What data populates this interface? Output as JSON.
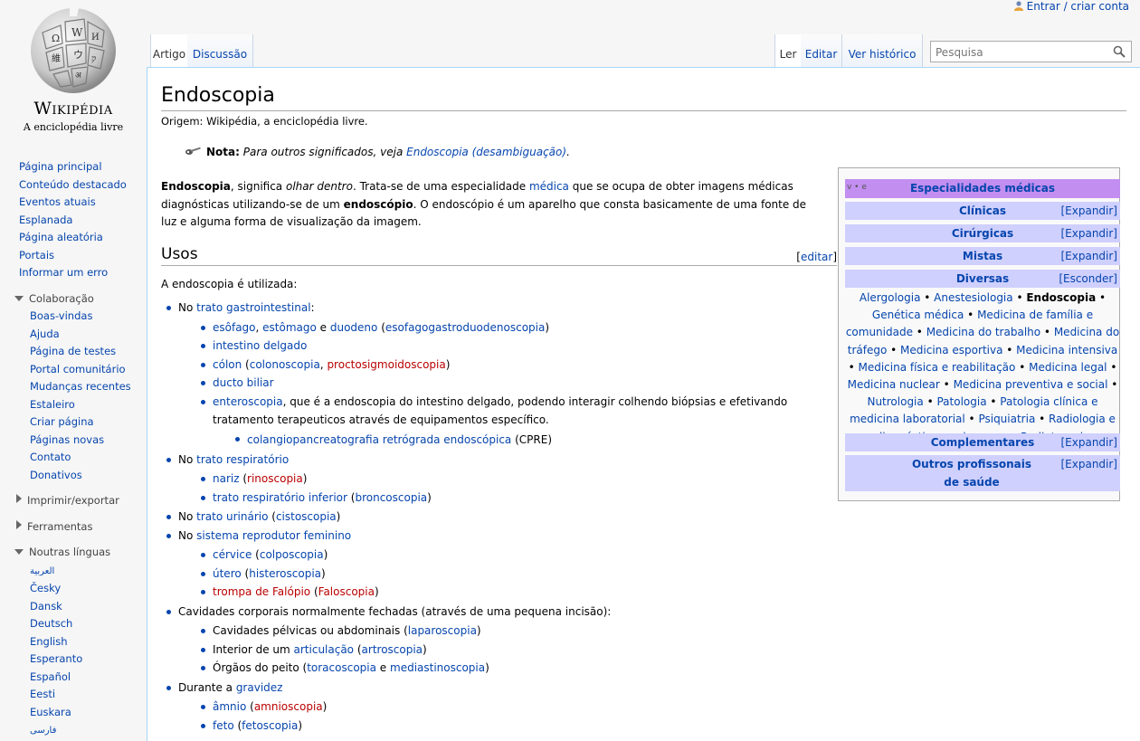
{
  "personal": {
    "login": "Entrar / criar conta"
  },
  "logo": {
    "wordmark": "Wikipédia",
    "tagline": "A enciclopédia livre"
  },
  "sidebar": {
    "main": [
      "Página principal",
      "Conteúdo destacado",
      "Eventos atuais",
      "Esplanada",
      "Página aleatória",
      "Portais",
      "Informar um erro"
    ],
    "collab_head": "Colaboração",
    "collab": [
      "Boas-vindas",
      "Ajuda",
      "Página de testes",
      "Portal comunitário",
      "Mudanças recentes",
      "Estaleiro",
      "Criar página",
      "Páginas novas",
      "Contato",
      "Donativos"
    ],
    "print_head": "Imprimir/exportar",
    "tools_head": "Ferramentas",
    "langs_head": "Noutras línguas",
    "langs": [
      "العربية",
      "Česky",
      "Dansk",
      "Deutsch",
      "English",
      "Esperanto",
      "Español",
      "Eesti",
      "Euskara",
      "فارسی"
    ]
  },
  "tabs": {
    "article": "Artigo",
    "discussion": "Discussão",
    "read": "Ler",
    "edit": "Editar",
    "history": "Ver histórico"
  },
  "search": {
    "placeholder": "Pesquisa"
  },
  "article": {
    "title": "Endoscopia",
    "sitesub": "Origem: Wikipédia, a enciclopédia livre.",
    "hatnote": {
      "label": "Nota:",
      "text": "Para outros significados, veja",
      "link": "Endoscopia (desambiguação)",
      "end": "."
    },
    "intro": {
      "t1": "Endoscopia",
      "t2": ", significa ",
      "t3": "olhar dentro",
      "t4": ". Trata-se de uma especialidade ",
      "l1": "médica",
      "t5": " que se ocupa de obter imagens médicas diagnósticas utilizando-se de um ",
      "t6": "endoscópio",
      "t7": ". O endoscópio é um aparelho que consta basicamente de uma fonte de luz e alguma forma de visualização da imagem."
    },
    "usos": {
      "heading": "Usos",
      "edit": "editar",
      "intro": "A endoscopia é utilizada:"
    },
    "uses": {
      "gi": {
        "pre": "No ",
        "link": "trato gastrointestinal",
        "post": ":"
      },
      "gi_items": {
        "a1": "esôfago",
        "a2": ", ",
        "a3": "estômago",
        "a4": " e ",
        "a5": "duodeno",
        "a6": " (",
        "a7": "esofagogastroduodenoscopia",
        "a8": ")",
        "b": "intestino delgado",
        "c1": "cólon",
        "c2": " (",
        "c3": "colonoscopia",
        "c4": ", ",
        "c5": "proctosigmoidoscopia",
        "c6": ")",
        "d": "ducto biliar",
        "e1": "enteroscopia",
        "e2": ", que é a endoscopia do intestino delgado, podendo interagir colhendo biópsias e efetivando tratamento terapeuticos através de equipamentos específico.",
        "f1": "colangiopancreatografia retrógrada endoscópica",
        "f2": " (CPRE)"
      },
      "resp": {
        "pre": "No ",
        "link": "trato respiratório"
      },
      "resp_items": {
        "a1": "nariz",
        "a2": " (",
        "a3": "rinoscopia",
        "a4": ")",
        "b1": "trato respiratório inferior",
        "b2": " (",
        "b3": "broncoscopia",
        "b4": ")"
      },
      "urin": {
        "pre": "No ",
        "link": "trato urinário",
        "p2": " (",
        "link2": "cistoscopia",
        "p3": ")"
      },
      "repro": {
        "pre": "No ",
        "link": "sistema reprodutor feminino"
      },
      "repro_items": {
        "a1": "cérvice",
        "a2": " (",
        "a3": "colposcopia",
        "a4": ")",
        "b1": "útero",
        "b2": " (",
        "b3": "histeroscopia",
        "b4": ")",
        "c1": "trompa de Falópio",
        "c2": " (",
        "c3": "Faloscopia",
        "c4": ")"
      },
      "closed": "Cavidades corporais normalmente fechadas (através de uma pequena incisão):",
      "closed_items": {
        "a1": "Cavidades pélvicas ou abdominais (",
        "a2": "laparoscopia",
        "a3": ")",
        "b1": "Interior de um ",
        "b2": "articulação",
        "b3": " (",
        "b4": "artroscopia",
        "b5": ")",
        "c1": "Órgãos do peito (",
        "c2": "toracoscopia",
        "c3": " e ",
        "c4": "mediastinoscopia",
        "c5": ")"
      },
      "preg": {
        "pre": "Durante a ",
        "link": "gravidez"
      },
      "preg_items": {
        "a1": "âmnio",
        "a2": " (",
        "a3": "amnioscopia",
        "a4": ")",
        "b1": "feto",
        "b2": " (",
        "b3": "fetoscopia",
        "b4": ")"
      }
    }
  },
  "navbox": {
    "vte": "v • e",
    "title": "Especialidades médicas",
    "groups": [
      {
        "name": "Clínicas",
        "toggle": "[Expandir]"
      },
      {
        "name": "Cirúrgicas",
        "toggle": "[Expandir]"
      },
      {
        "name": "Mistas",
        "toggle": "[Expandir]"
      },
      {
        "name": "Diversas",
        "toggle": "[Esconder]"
      },
      {
        "name": "Complementares",
        "toggle": "[Expandir]"
      },
      {
        "name": "Outros profissonais de saúde",
        "toggle": "[Expandir]"
      }
    ],
    "diversas": [
      "Alergologia",
      "Anestesiologia",
      "Endoscopia",
      "Genética médica",
      "Medicina de família e comunidade",
      "Medicina do trabalho",
      "Medicina do tráfego",
      "Medicina esportiva",
      "Medicina intensiva",
      "Medicina física e reabilitação",
      "Medicina legal",
      "Medicina nuclear",
      "Medicina preventiva e social",
      "Nutrologia",
      "Patologia",
      "Patologia clínica e medicina laboratorial",
      "Psiquiatria",
      "Radiologia e diagnóstico por imagem",
      "Radioterapia"
    ],
    "separator": " • "
  },
  "icons": {
    "user": "user-icon",
    "search": "search-icon",
    "globe": "wikipedia-globe-icon",
    "note": "tool-icon"
  }
}
